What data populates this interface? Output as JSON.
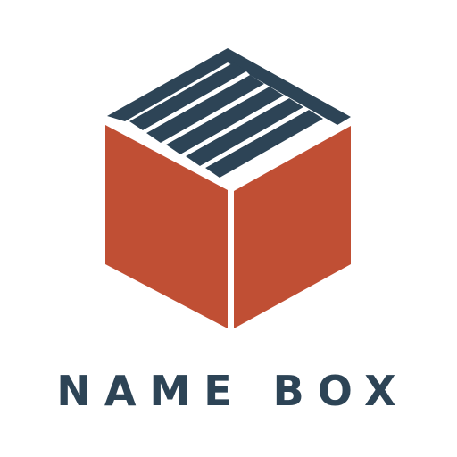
{
  "logo": {
    "wordmark": "NAME BOX",
    "icon": "open-box-with-files-icon",
    "colors": {
      "box": "#c04f34",
      "navy": "#2d4456",
      "background": "#ffffff"
    }
  }
}
